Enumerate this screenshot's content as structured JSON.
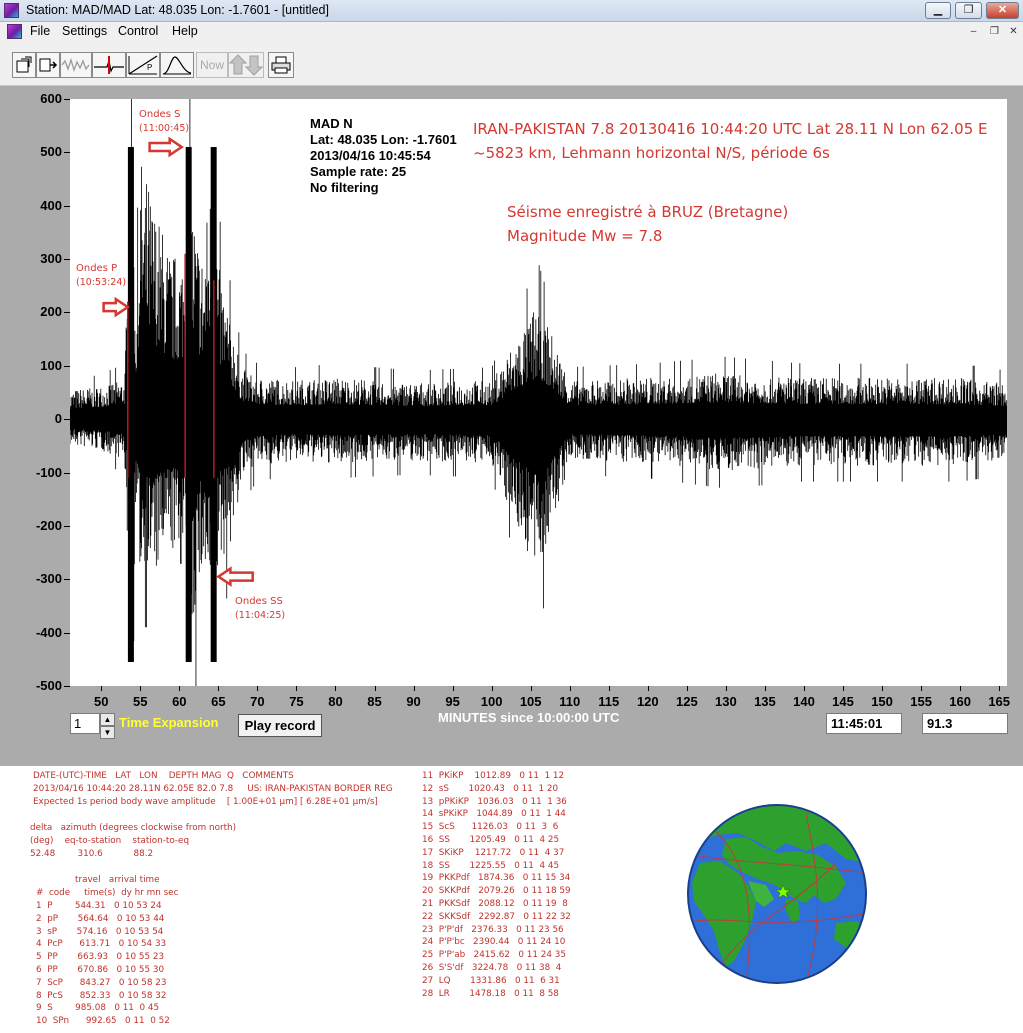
{
  "window": {
    "title": "Station: MAD/MAD Lat: 48.035 Lon: -1.7601 - [untitled]",
    "min_glyph": "▁",
    "max_glyph": "❐",
    "close_glyph": "✕"
  },
  "menu": {
    "items": [
      "File",
      "Settings",
      "Control",
      "Help"
    ],
    "mdi_min": "–",
    "mdi_restore": "❐",
    "mdi_close": "✕"
  },
  "toolbar": {
    "now_label": "Now",
    "icons": [
      "open-file-icon",
      "save-file-icon",
      "waveform-icon",
      "pick-icon",
      "travel-time-icon",
      "spectrum-icon",
      "now-button",
      "up-down-arrows-icon",
      "print-icon"
    ]
  },
  "plot": {
    "station_block": {
      "line1": "MAD  N",
      "line2": "Lat: 48.035 Lon: -1.7601",
      "line3": "2013/04/16 10:45:54",
      "line4": "Sample rate: 25",
      "line5": "No filtering"
    },
    "event_title_line1": "IRAN-PAKISTAN 7.8 20130416 10:44:20 UTC Lat 28.11 N Lon 62.05 E",
    "event_title_line2": "~5823 km, Lehmann horizontal N/S, période 6s",
    "bruz_line1": "Séisme enregistré à BRUZ (Bretagne)",
    "bruz_line2": "Magnitude Mw = 7.8",
    "ondes_s": {
      "label": "Ondes S",
      "time": "(11:00:45)"
    },
    "ondes_p": {
      "label": "Ondes P",
      "time": "(10:53:24)"
    },
    "ondes_ss": {
      "label": "Ondes SS",
      "time": "(11:04:25)"
    }
  },
  "controls": {
    "expansion_value": "1",
    "time_expansion_label": "Time Expansion",
    "play_button": "Play record",
    "x_axis_title": "MINUTES since 10:00:00 UTC",
    "time_readout": "11:45:01",
    "value_readout": "91.3"
  },
  "chart_data": {
    "type": "line",
    "title": "",
    "xlabel": "MINUTES since 10:00:00 UTC",
    "ylabel": "",
    "xlim": [
      46,
      166
    ],
    "ylim": [
      -500,
      600
    ],
    "x_ticks": [
      50,
      55,
      60,
      65,
      70,
      75,
      80,
      85,
      90,
      95,
      100,
      105,
      110,
      115,
      120,
      125,
      130,
      135,
      140,
      145,
      150,
      155,
      160,
      165
    ],
    "y_ticks": [
      600,
      500,
      400,
      300,
      200,
      100,
      0,
      -100,
      -200,
      -300,
      -400,
      -500
    ],
    "series": [
      {
        "description_free": true,
        "envelope": [
          [
            46,
            55,
            -50
          ],
          [
            50,
            65,
            -60
          ],
          [
            53,
            80,
            -80
          ],
          [
            53.8,
            510,
            -455
          ],
          [
            54.5,
            210,
            -200
          ],
          [
            55,
            500,
            -300
          ],
          [
            57,
            400,
            -300
          ],
          [
            59,
            310,
            -250
          ],
          [
            60.9,
            330,
            -300
          ],
          [
            61.2,
            515,
            -455
          ],
          [
            62,
            380,
            -400
          ],
          [
            63,
            320,
            -300
          ],
          [
            64.4,
            510,
            -455
          ],
          [
            65,
            300,
            -280
          ],
          [
            66.5,
            200,
            -250
          ],
          [
            68,
            100,
            -120
          ],
          [
            70,
            80,
            -90
          ],
          [
            75,
            75,
            -80
          ],
          [
            80,
            80,
            -85
          ],
          [
            90,
            70,
            -80
          ],
          [
            100,
            75,
            -85
          ],
          [
            106,
            225,
            -310
          ],
          [
            110,
            75,
            -80
          ],
          [
            120,
            80,
            -85
          ],
          [
            130,
            90,
            -100
          ],
          [
            140,
            80,
            -90
          ],
          [
            150,
            80,
            -90
          ],
          [
            160,
            80,
            -90
          ],
          [
            166,
            70,
            -80
          ]
        ]
      }
    ],
    "phase_markers": [
      {
        "label": "Ondes P",
        "time": "(10:53:24)",
        "x": 53.4
      },
      {
        "label": "Ondes S",
        "time": "(11:00:45)",
        "x": 60.75
      },
      {
        "label": "Ondes SS",
        "time": "(11:04:25)",
        "x": 64.42
      }
    ]
  },
  "event_info": {
    "header": "DATE-(UTC)-TIME   LAT   LON    DEPTH MAG  Q   COMMENTS",
    "line1": "2013/04/16 10:44:20 28.11N 62.05E 82.0 7.8     US: IRAN-PAKISTAN BORDER REG",
    "line2": "Expected 1s period body wave amplitude    [ 1.00E+01 µm] [ 6.28E+01 µm/s]",
    "delta_header": "delta   azimuth (degrees clockwise from north)",
    "delta_units": "(deg)    eq-to-station    station-to-eq",
    "delta_values": "52.48        310.6           88.2",
    "travel_header1": "travel   arrival time",
    "travel_header2": "#  code     time(s)  dy hr mn sec"
  },
  "phases_left": [
    "1  P        544.31   0 10 53 24",
    "2  pP       564.64   0 10 53 44",
    "3  sP       574.16   0 10 53 54",
    "4  PcP      613.71   0 10 54 33",
    "5  PP       663.93   0 10 55 23",
    "6  PP       670.86   0 10 55 30",
    "7  ScP      843.27   0 10 58 23",
    "8  PcS      852.33   0 10 58 32",
    "9  S        985.08   0 11  0 45",
    "10  SPn      992.65   0 11  0 52"
  ],
  "phases_right": [
    "11  PKiKP    1012.89   0 11  1 12",
    "12  sS       1020.43   0 11  1 20",
    "13  pPKiKP   1036.03   0 11  1 36",
    "14  sPKiKP   1044.89   0 11  1 44",
    "15  ScS      1126.03   0 11  3  6",
    "16  SS       1205.49   0 11  4 25",
    "17  SKiKP    1217.72   0 11  4 37",
    "18  SS       1225.55   0 11  4 45",
    "19  PKKPdf   1874.36   0 11 15 34",
    "20  SKKPdf   2079.26   0 11 18 59",
    "21  PKKSdf   2088.12   0 11 19  8",
    "22  SKKSdf   2292.87   0 11 22 32",
    "23  P'P'df   2376.33   0 11 23 56",
    "24  P'P'bc   2390.44   0 11 24 10",
    "25  P'P'ab   2415.62   0 11 24 35",
    "26  S'S'df   3224.78   0 11 38  4",
    "27  LQ       1331.86   0 11  6 31",
    "28  LR       1478.18   0 11  8 58"
  ],
  "colors": {
    "annotation": "#d43830",
    "plot_bg": "#ababab",
    "time_expansion": "#ffff33",
    "ocean": "#2f6fd8",
    "land": "#2ea02e"
  }
}
